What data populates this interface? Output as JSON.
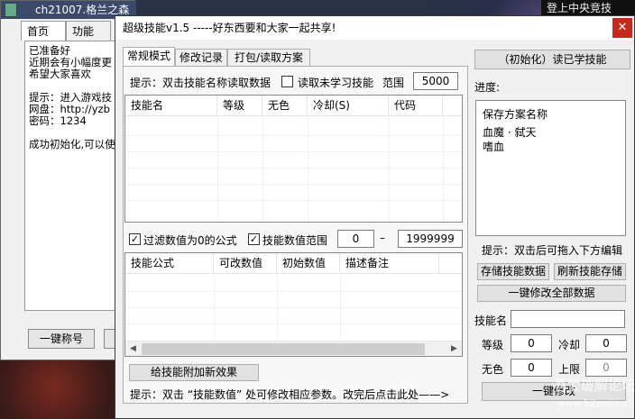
{
  "background": {
    "banner_text": "登上中央竞技"
  },
  "back_window": {
    "title": "ch21007.格兰之森",
    "tabs": [
      "首页",
      "功能"
    ],
    "log_lines": [
      "已准备好",
      "近期会有小幅度更",
      "希望大家喜欢",
      "",
      "提示：进入游戏技",
      "网盘：http://yzb",
      "密码：1234",
      "",
      "成功初始化,可以使"
    ],
    "button_title": "一键称号"
  },
  "main": {
    "title": "超级技能v1.5   -----好东西要和大家一起共享!",
    "close_glyph": "✕",
    "tabs": [
      "常规模式",
      "修改记录",
      "打包/读取方案"
    ],
    "hint_top": "提示：双击技能名称读取数据",
    "unlearned_label": "读取未学习技能",
    "range_label": "范围",
    "range_value": "5000",
    "skill_columns": [
      "技能名",
      "等级",
      "无色",
      "冷却(S)",
      "代码"
    ],
    "filter_zero_label": "过滤数值为0的公式",
    "range_filter_label": "技能数值范围",
    "range_min": "0",
    "range_dash": "–",
    "range_max": "1999999",
    "formula_columns": [
      "技能公式",
      "可改数值",
      "初始数值",
      "描述备注"
    ],
    "add_effect_button": "给技能附加新效果",
    "hint_bottom": "提示：双击 “技能数值” 处可修改相应参数。改完后点击此处——>",
    "right": {
      "read_button": "（初始化）读已学技能",
      "progress_label": "进度:",
      "plan_header": "保存方案名称",
      "plans": [
        "血魔 · 弑天",
        "嗜血"
      ],
      "hint_drag": "提示：双击后可拖入下方编辑",
      "save_button": "存储技能数据",
      "refresh_button": "刷新技能存储",
      "modify_all_button": "一键修改全部数据",
      "skill_name_label": "技能名",
      "skill_name_value": "",
      "level_label": "等级",
      "level_value": "0",
      "cooldown_label": "冷却",
      "cooldown_value": "0",
      "colorless_label": "无色",
      "colorless_value": "0",
      "upper_label": "上限",
      "upper_value": "0",
      "apply_button": "一键修改"
    }
  },
  "watermark": {
    "line1": "吾爱破解论坛",
    "line2": "www.52pojie.cn"
  }
}
